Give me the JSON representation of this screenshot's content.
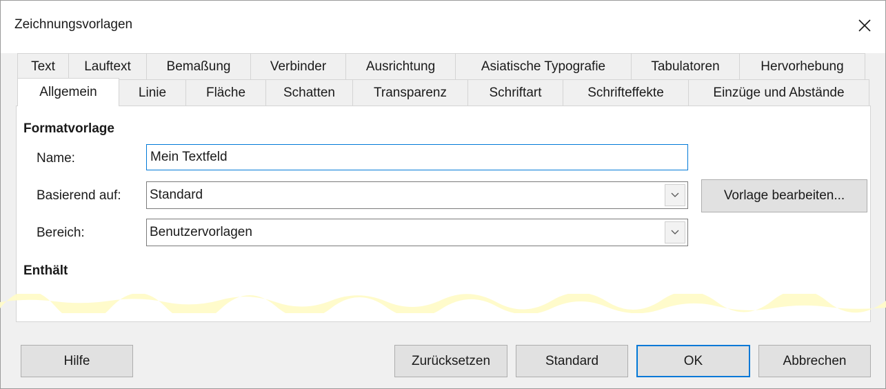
{
  "window": {
    "title": "Zeichnungsvorlagen"
  },
  "tabs": {
    "row1": [
      "Text",
      "Lauftext",
      "Bemaßung",
      "Verbinder",
      "Ausrichtung",
      "Asiatische Typografie",
      "Tabulatoren",
      "Hervorhebung"
    ],
    "row2": [
      "Allgemein",
      "Linie",
      "Fläche",
      "Schatten",
      "Transparenz",
      "Schriftart",
      "Schrifteffekte",
      "Einzüge und Abstände"
    ],
    "active": "Allgemein"
  },
  "formatvorlage": {
    "heading": "Formatvorlage",
    "name_label": "Name:",
    "name_value": "Mein Textfeld",
    "based_on_label": "Basierend auf:",
    "based_on_value": "Standard",
    "category_label": "Bereich:",
    "category_value": "Benutzervorlagen",
    "edit_style_button": "Vorlage bearbeiten..."
  },
  "contains": {
    "heading": "Enthält"
  },
  "footer": {
    "help": "Hilfe",
    "reset": "Zurücksetzen",
    "standard": "Standard",
    "ok": "OK",
    "cancel": "Abbrechen"
  },
  "colors": {
    "focus_border": "#0078d7",
    "dialog_bg": "#f0f0f0",
    "highlight": "#fffbc8"
  },
  "icons": {
    "close": "close-icon",
    "dropdown": "chevron-down-icon"
  }
}
